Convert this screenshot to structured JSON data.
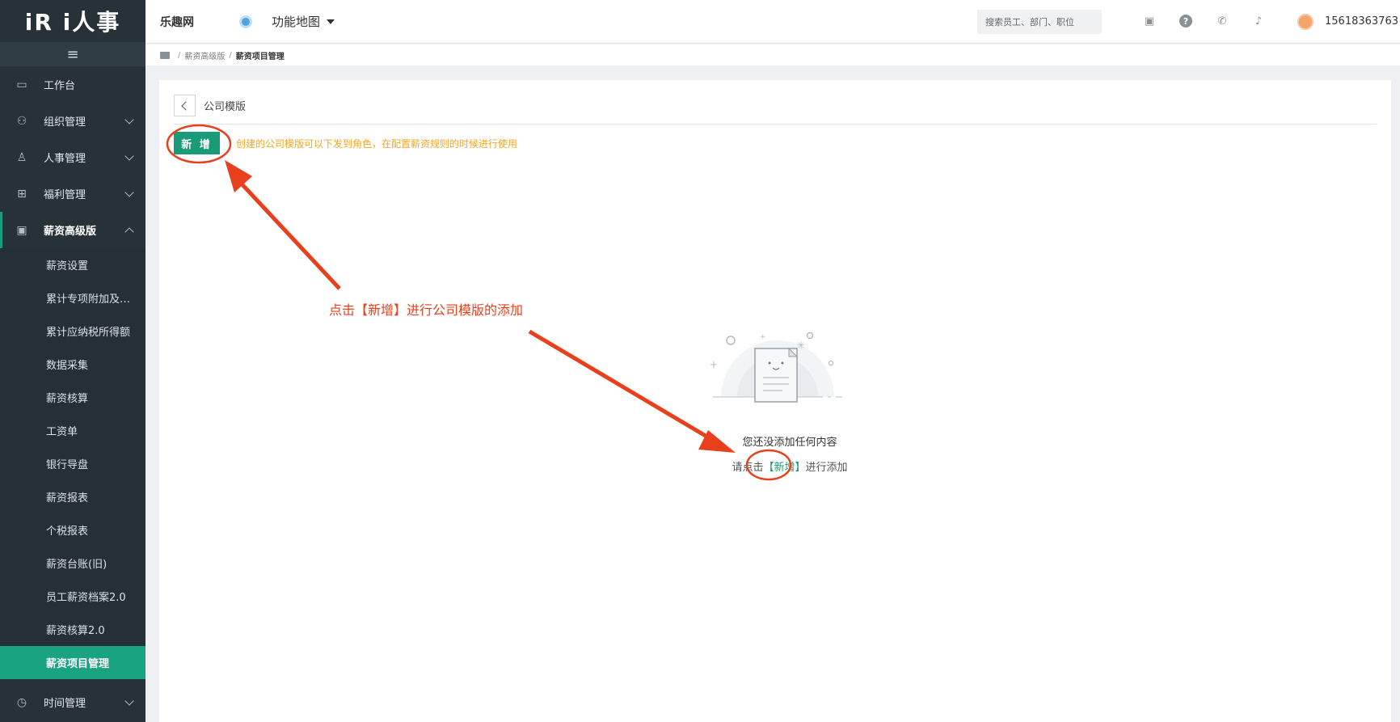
{
  "app": {
    "logo_text": "iR i人事"
  },
  "sidebar": {
    "collapse_icon": "≡",
    "items": [
      {
        "label": "工作台",
        "icon": "monitor-icon"
      },
      {
        "label": "组织管理",
        "icon": "org-chart-icon"
      },
      {
        "label": "人事管理",
        "icon": "person-icon"
      },
      {
        "label": "福利管理",
        "icon": "gift-icon"
      },
      {
        "label": "薪资高级版",
        "icon": "wallet-icon"
      }
    ],
    "sub_items": [
      "薪资设置",
      "累计专项附加及…",
      "累计应纳税所得额",
      "数据采集",
      "薪资核算",
      "工资单",
      "银行导盘",
      "薪资报表",
      "个税报表",
      "薪资台账(旧)",
      "员工薪资档案2.0",
      "薪资核算2.0",
      "薪资项目管理"
    ],
    "active_sub": "薪资项目管理",
    "bottom_item": {
      "label": "时间管理",
      "icon": "clock-icon"
    }
  },
  "header": {
    "company": "乐趣网",
    "feature_map": "功能地图",
    "search_placeholder": "搜索员工、部门、职位",
    "user_phone": "15618363763"
  },
  "breadcrumb": {
    "items": [
      "薪资高级版",
      "薪资项目管理"
    ]
  },
  "main": {
    "title": "公司模版",
    "add_button": "新 增",
    "hint": "创建的公司模版可以下发到角色，在配置薪资规则的时候进行使用",
    "empty_title": "您还没添加任何内容",
    "empty_sub_prefix": "请点击",
    "empty_sub_link": "【新增】",
    "empty_sub_suffix": "进行添加"
  },
  "annotation": {
    "text": "点击【新增】进行公司模版的添加",
    "color": "#e8401c"
  },
  "colors": {
    "sidebar_bg": "#263238",
    "accent": "#1a9b78",
    "hint": "#f5a623"
  }
}
